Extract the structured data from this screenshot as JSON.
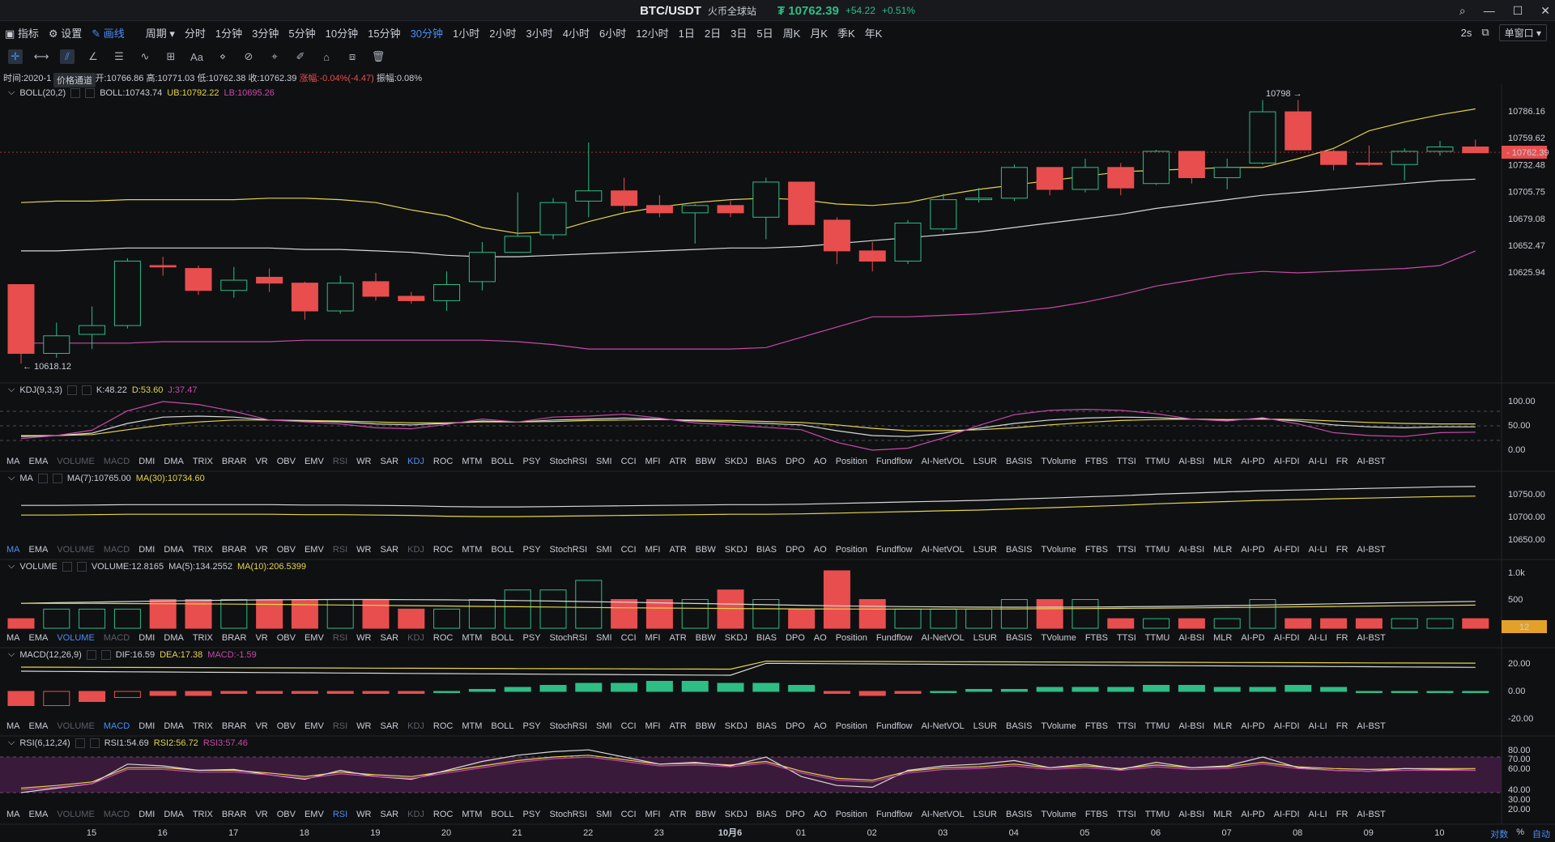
{
  "titlebar": {
    "pair": "BTC/USDT",
    "site": "火币全球站",
    "price": "₮ 10762.39",
    "change": "+54.22",
    "change_pct": "+0.51%"
  },
  "toolbar": {
    "indicator": "指标",
    "settings": "设置",
    "draw": "画线",
    "period_label": "周期",
    "periods": [
      "分时",
      "1分钟",
      "3分钟",
      "5分钟",
      "10分钟",
      "15分钟",
      "30分钟",
      "1小时",
      "2小时",
      "3小时",
      "4小时",
      "6小时",
      "12小时",
      "1日",
      "2日",
      "3日",
      "5日",
      "周K",
      "月K",
      "季K",
      "年K"
    ],
    "active_period": "30分钟",
    "refresh": "2s",
    "window_select": "单窗口"
  },
  "info": {
    "time": "时间:2020-1",
    "open": "开:10766.86",
    "high": "高:10771.03",
    "low": "低:10762.38",
    "close": "收:10762.39",
    "change": "涨幅:-0.04%(-4.47)",
    "amplitude": "振幅:0.08%",
    "tooltip": "价格通道"
  },
  "panels": {
    "boll": {
      "name": "BOLL(20,2)",
      "boll": "BOLL:10743.74",
      "ub": "UB:10792.22",
      "lb": "LB:10695.26"
    },
    "kdj": {
      "name": "KDJ(9,3,3)",
      "k": "K:48.22",
      "d": "D:53.60",
      "j": "J:37.47"
    },
    "ma": {
      "name": "MA",
      "ma7": "MA(7):10765.00",
      "ma30": "MA(30):10734.60"
    },
    "volume": {
      "name": "VOLUME",
      "vol": "VOLUME:12.8165",
      "ma5": "MA(5):134.2552",
      "ma10": "MA(10):206.5399"
    },
    "macd": {
      "name": "MACD(12,26,9)",
      "dif": "DIF:16.59",
      "dea": "DEA:17.38",
      "macd": "MACD:-1.59"
    },
    "rsi": {
      "name": "RSI(6,12,24)",
      "rsi1": "RSI1:54.69",
      "rsi2": "RSI2:56.72",
      "rsi3": "RSI3:57.46"
    }
  },
  "indicator_list": [
    "MA",
    "EMA",
    "VOLUME",
    "MACD",
    "DMI",
    "DMA",
    "TRIX",
    "BRAR",
    "VR",
    "OBV",
    "EMV",
    "RSI",
    "WR",
    "SAR",
    "KDJ",
    "ROC",
    "MTM",
    "BOLL",
    "PSY",
    "StochRSI",
    "SMI",
    "CCI",
    "MFI",
    "ATR",
    "BBW",
    "SKDJ",
    "BIAS",
    "DPO",
    "AO",
    "Position",
    "Fundflow",
    "AI-NetVOL",
    "LSUR",
    "BASIS",
    "TVolume",
    "FTBS",
    "TTSI",
    "TTMU",
    "AI-BSI",
    "MLR",
    "AI-PD",
    "AI-FDI",
    "AI-LI",
    "FR",
    "AI-BST"
  ],
  "axes": {
    "price_ticks": [
      "10786.16",
      "10759.62",
      "10732.48",
      "10705.75",
      "10679.08",
      "10652.47",
      "10625.94"
    ],
    "current_price": "10762.39",
    "high_mark": "10798",
    "low_mark": "10618.12",
    "kdj_ticks": [
      "100.00",
      "50.00",
      "0.00"
    ],
    "ma_ticks": [
      "10750.00",
      "10700.00",
      "10650.00"
    ],
    "vol_ticks": [
      "1.0k",
      "500"
    ],
    "vol_current": "12",
    "macd_ticks": [
      "20.00",
      "0.00",
      "-20.00"
    ],
    "rsi_ticks": [
      "80.00",
      "70.00",
      "60.00",
      "40.00",
      "30.00",
      "20.00"
    ],
    "x_labels": [
      "15",
      "16",
      "17",
      "18",
      "19",
      "20",
      "21",
      "22",
      "23",
      "10月6",
      "01",
      "02",
      "03",
      "04",
      "05",
      "06",
      "07",
      "08",
      "09",
      "10"
    ]
  },
  "bottom_right": {
    "log": "对数",
    "pct": "%",
    "auto": "自动"
  },
  "colors": {
    "up": "#2ebd85",
    "down": "#e84e4e",
    "accent": "#4a8df8",
    "boll_mid": "#d8d8d8",
    "boll_ub": "#e4d44a",
    "boll_lb": "#c84aa8"
  },
  "chart_data": {
    "type": "candlestick",
    "candles": [
      {
        "o": 10672,
        "c": 10625,
        "h": 10672,
        "l": 10618
      },
      {
        "o": 10625,
        "c": 10637,
        "h": 10646,
        "l": 10622
      },
      {
        "o": 10638,
        "c": 10644,
        "h": 10657,
        "l": 10628
      },
      {
        "o": 10644,
        "c": 10688,
        "h": 10690,
        "l": 10642
      },
      {
        "o": 10685,
        "c": 10684,
        "h": 10691,
        "l": 10678
      },
      {
        "o": 10683,
        "c": 10668,
        "h": 10685,
        "l": 10665
      },
      {
        "o": 10668,
        "c": 10675,
        "h": 10684,
        "l": 10663
      },
      {
        "o": 10677,
        "c": 10673,
        "h": 10683,
        "l": 10667
      },
      {
        "o": 10673,
        "c": 10654,
        "h": 10674,
        "l": 10648
      },
      {
        "o": 10654,
        "c": 10673,
        "h": 10678,
        "l": 10652
      },
      {
        "o": 10674,
        "c": 10664,
        "h": 10680,
        "l": 10661
      },
      {
        "o": 10664,
        "c": 10661,
        "h": 10667,
        "l": 10659
      },
      {
        "o": 10661,
        "c": 10672,
        "h": 10681,
        "l": 10654
      },
      {
        "o": 10674,
        "c": 10694,
        "h": 10701,
        "l": 10668
      },
      {
        "o": 10694,
        "c": 10705,
        "h": 10735,
        "l": 10694
      },
      {
        "o": 10706,
        "c": 10728,
        "h": 10731,
        "l": 10703
      },
      {
        "o": 10729,
        "c": 10736,
        "h": 10769,
        "l": 10718
      },
      {
        "o": 10736,
        "c": 10726,
        "h": 10745,
        "l": 10722
      },
      {
        "o": 10726,
        "c": 10721,
        "h": 10733,
        "l": 10718
      },
      {
        "o": 10721,
        "c": 10726,
        "h": 10727,
        "l": 10700
      },
      {
        "o": 10726,
        "c": 10721,
        "h": 10729,
        "l": 10718
      },
      {
        "o": 10718,
        "c": 10742,
        "h": 10745,
        "l": 10703
      },
      {
        "o": 10742,
        "c": 10713,
        "h": 10742,
        "l": 10713
      },
      {
        "o": 10716,
        "c": 10695,
        "h": 10718,
        "l": 10686
      },
      {
        "o": 10695,
        "c": 10688,
        "h": 10701,
        "l": 10681
      },
      {
        "o": 10688,
        "c": 10714,
        "h": 10716,
        "l": 10686
      },
      {
        "o": 10710,
        "c": 10730,
        "h": 10734,
        "l": 10708
      },
      {
        "o": 10730,
        "c": 10731,
        "h": 10738,
        "l": 10728
      },
      {
        "o": 10731,
        "c": 10752,
        "h": 10754,
        "l": 10729
      },
      {
        "o": 10752,
        "c": 10737,
        "h": 10752,
        "l": 10733
      },
      {
        "o": 10737,
        "c": 10752,
        "h": 10758,
        "l": 10735
      },
      {
        "o": 10752,
        "c": 10738,
        "h": 10755,
        "l": 10733
      },
      {
        "o": 10741,
        "c": 10763,
        "h": 10764,
        "l": 10740
      },
      {
        "o": 10763,
        "c": 10745,
        "h": 10763,
        "l": 10741
      },
      {
        "o": 10745,
        "c": 10752,
        "h": 10758,
        "l": 10737
      },
      {
        "o": 10755,
        "c": 10790,
        "h": 10798,
        "l": 10754
      },
      {
        "o": 10790,
        "c": 10764,
        "h": 10798,
        "l": 10764
      },
      {
        "o": 10763,
        "c": 10754,
        "h": 10764,
        "l": 10750
      },
      {
        "o": 10755,
        "c": 10754,
        "h": 10767,
        "l": 10753
      },
      {
        "o": 10754,
        "c": 10763,
        "h": 10765,
        "l": 10743
      },
      {
        "o": 10763,
        "c": 10766,
        "h": 10770,
        "l": 10760
      },
      {
        "o": 10766,
        "c": 10762,
        "h": 10771,
        "l": 10762
      }
    ],
    "boll_mid": [
      10695,
      10695,
      10696,
      10697,
      10697,
      10697,
      10697,
      10697,
      10696,
      10696,
      10695,
      10694,
      10692,
      10691,
      10691,
      10692,
      10693,
      10694,
      10695,
      10696,
      10697,
      10697,
      10698,
      10700,
      10702,
      10704,
      10706,
      10708,
      10711,
      10714,
      10717,
      10720,
      10724,
      10727,
      10730,
      10733,
      10735,
      10737,
      10739,
      10741,
      10743,
      10744
    ],
    "boll_ub": [
      10728,
      10729,
      10729,
      10730,
      10730,
      10730,
      10730,
      10731,
      10731,
      10730,
      10728,
      10723,
      10719,
      10711,
      10707,
      10708,
      10715,
      10721,
      10725,
      10728,
      10730,
      10731,
      10730,
      10727,
      10726,
      10728,
      10733,
      10737,
      10740,
      10743,
      10746,
      10749,
      10750,
      10751,
      10752,
      10752,
      10758,
      10765,
      10777,
      10783,
      10788,
      10792
    ],
    "boll_lb": [
      10632,
      10632,
      10632,
      10632,
      10633,
      10633,
      10633,
      10633,
      10634,
      10634,
      10634,
      10634,
      10634,
      10634,
      10633,
      10631,
      10628,
      10628,
      10628,
      10628,
      10628,
      10629,
      10636,
      10643,
      10650,
      10650,
      10651,
      10652,
      10654,
      10656,
      10660,
      10665,
      10671,
      10675,
      10679,
      10681,
      10680,
      10681,
      10682,
      10683,
      10685,
      10695
    ],
    "volume": [
      1,
      2,
      2,
      2,
      3,
      3,
      3,
      3,
      3,
      3,
      3,
      2,
      2,
      3,
      4,
      4,
      5,
      3,
      3,
      3,
      4,
      3,
      2,
      6,
      3,
      2,
      2,
      2,
      3,
      3,
      3,
      1,
      1,
      1,
      1,
      3,
      1,
      1,
      1,
      1,
      1,
      1
    ],
    "macd_hist": [
      -7,
      -7,
      -5,
      -3,
      -2,
      -2,
      -1,
      -1,
      -1,
      -1,
      -1,
      -1,
      0,
      1,
      2,
      3,
      4,
      4,
      5,
      5,
      4,
      4,
      3,
      -1,
      -2,
      -1,
      0,
      1,
      1,
      2,
      2,
      2,
      3,
      3,
      2,
      2,
      3,
      2,
      0,
      0,
      0,
      0
    ]
  }
}
